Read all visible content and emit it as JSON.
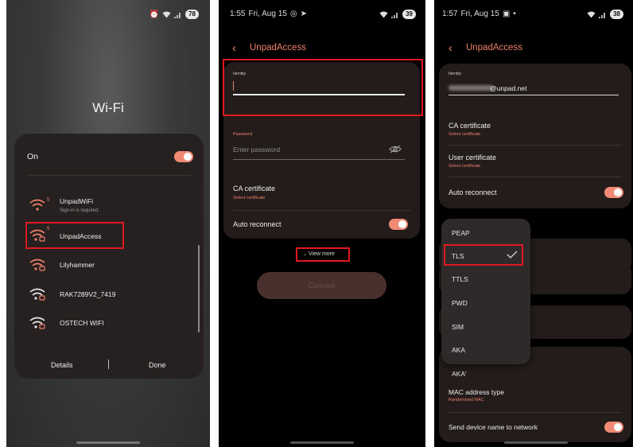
{
  "panel1": {
    "status": {
      "battery": "78"
    },
    "title": "Wi-Fi",
    "on_label": "On",
    "networks": [
      {
        "name": "UnpadWiFi",
        "sub": "Sign-in is required.",
        "badge": "5"
      },
      {
        "name": "UnpadAccess",
        "sub": "",
        "badge": "5"
      },
      {
        "name": "Lilyhammer",
        "sub": "",
        "badge": ""
      },
      {
        "name": "RAK7289V2_7419",
        "sub": "",
        "badge": ""
      },
      {
        "name": "OSTECH WIFI",
        "sub": "",
        "badge": ""
      }
    ],
    "details_label": "Details",
    "done_label": "Done"
  },
  "panel2": {
    "status": {
      "time": "1:55",
      "date": "Fri, Aug 15",
      "battery": "39"
    },
    "title": "UnpadAccess",
    "identity_label": "Identity",
    "password_label": "Password",
    "password_placeholder": "Enter password",
    "ca_label": "CA certificate",
    "ca_sub": "Select certificate",
    "auto_reconnect": "Auto reconnect",
    "view_more": "View more",
    "connect": "Connect"
  },
  "panel3": {
    "status": {
      "time": "1:57",
      "date": "Fri, Aug 15",
      "battery": "38"
    },
    "title": "UnpadAccess",
    "identity_label": "Identity",
    "identity_value": "@unpad.net",
    "ca_label": "CA certificate",
    "ca_sub": "Select certificate",
    "user_cert_label": "User certificate",
    "user_cert_sub": "Select certificate",
    "auto_reconnect": "Auto reconnect",
    "eap_options": [
      "PEAP",
      "TLS",
      "TTLS",
      "PWD",
      "SIM",
      "AKA",
      "AKA'"
    ],
    "selected_eap": "TLS",
    "mac_label": "MAC address type",
    "mac_sub": "Randomized MAC",
    "send_device_name": "Send device name to network"
  },
  "colors": {
    "accent": "#f07f6b",
    "highlight": "#e0191e",
    "toggle": "#f08a75"
  }
}
